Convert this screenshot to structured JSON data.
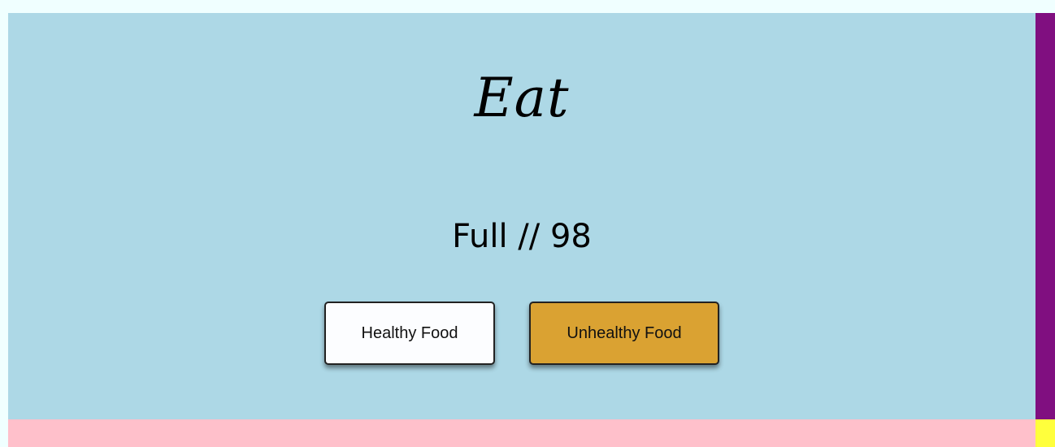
{
  "colors": {
    "page_background": "#F0FFFF",
    "panel_background": "#ADD8E6",
    "right_bar": "#800F80",
    "bottom_bar": "#FFC0CB",
    "corner_block": "#FFFF3C",
    "healthy_button": "#FCFDFF",
    "unhealthy_button": "#DAA232"
  },
  "main": {
    "title": "Eat",
    "status": {
      "text": "Full // 98"
    },
    "buttons": {
      "healthy_label": "Healthy Food",
      "unhealthy_label": "Unhealthy Food"
    }
  }
}
